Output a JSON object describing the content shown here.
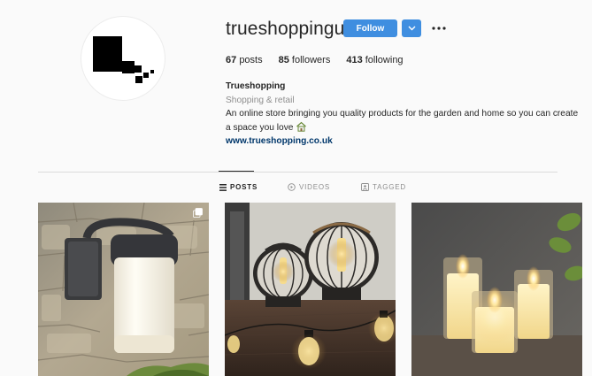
{
  "profile": {
    "username": "trueshoppinguk",
    "follow_label": "Follow",
    "stats": {
      "posts_count": "67",
      "posts_label": "posts",
      "followers_count": "85",
      "followers_label": "followers",
      "following_count": "413",
      "following_label": "following"
    },
    "bio": {
      "name": "Trueshopping",
      "category": "Shopping & retail",
      "description": "An online store bringing you quality products for the garden and home so you can create a space you love",
      "link": "www.trueshopping.co.uk"
    }
  },
  "tabs": {
    "posts": "POSTS",
    "videos": "VIDEOS",
    "tagged": "TAGGED"
  },
  "icons": {
    "more": "more-options-icon",
    "dropdown": "chevron-down-icon",
    "posts_tab": "grid-icon",
    "videos_tab": "play-circle-icon",
    "tagged_tab": "tag-person-icon",
    "bio_emoji": "house-icon",
    "multi": "multi-photo-icon"
  },
  "colors": {
    "accent": "#3f8ee0",
    "link": "#00376b",
    "muted": "#8e8e8e"
  }
}
